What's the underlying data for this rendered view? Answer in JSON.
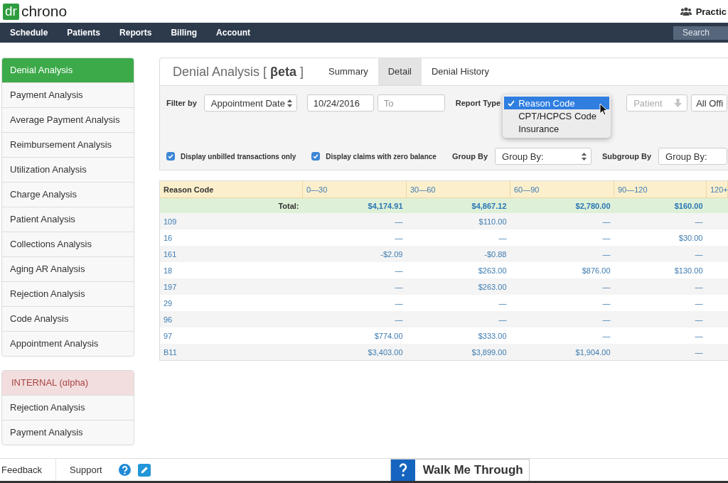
{
  "header": {
    "logo": {
      "mark": "dr",
      "name": "chrono"
    },
    "practice": "Practic"
  },
  "nav": {
    "items": [
      "Schedule",
      "Patients",
      "Reports",
      "Billing",
      "Account"
    ],
    "search": {
      "placeholder": "Search"
    }
  },
  "sidebar": {
    "items": [
      {
        "label": "Denial Analysis",
        "selected": true
      },
      {
        "label": "Payment Analysis",
        "selected": false
      },
      {
        "label": "Average Payment Analysis",
        "selected": false
      },
      {
        "label": "Reimbursement Analysis",
        "selected": false
      },
      {
        "label": "Utilization Analysis",
        "selected": false
      },
      {
        "label": "Charge Analysis",
        "selected": false
      },
      {
        "label": "Patient Analysis",
        "selected": false
      },
      {
        "label": "Collections Analysis",
        "selected": false
      },
      {
        "label": "Aging AR Analysis",
        "selected": false
      },
      {
        "label": "Rejection Analysis",
        "selected": false
      },
      {
        "label": "Code Analysis",
        "selected": false
      },
      {
        "label": "Appointment Analysis",
        "selected": false
      }
    ],
    "internal": {
      "title": "INTERNAL (αlpha)",
      "items": [
        {
          "label": "Rejection Analysis",
          "selected": false
        },
        {
          "label": "Payment Analysis",
          "selected": false
        }
      ]
    }
  },
  "report": {
    "title": "Denial Analysis [ **βeta** ]",
    "tabs": [
      {
        "label": "Summary",
        "selected": false
      },
      {
        "label": "Detail",
        "selected": true
      },
      {
        "label": "Denial History",
        "selected": false
      }
    ]
  },
  "filters": {
    "filter_by": {
      "label": "Filter by",
      "select": "Appointment Date",
      "date_from": "10/24/2016",
      "date_to_placeholder": "To"
    },
    "report_type": {
      "label": "Report Type",
      "options": [
        {
          "label": "Reason Code",
          "selected": true
        },
        {
          "label": "CPT/HCPCS Code",
          "selected": false
        },
        {
          "label": "Insurance",
          "selected": false
        }
      ]
    },
    "patient": {
      "placeholder": "Patient"
    },
    "office": {
      "value": "All Offi"
    },
    "checkboxes": [
      {
        "label": "Display unbilled transactions only",
        "checked": true
      },
      {
        "label": "Display claims with zero balance",
        "checked": true
      }
    ],
    "group_by": {
      "label": "Group By",
      "value": "Group By:"
    },
    "subgroup_by": {
      "label": "Subgroup By",
      "value": "Group By:"
    }
  },
  "table": {
    "columns": [
      "Reason Code",
      "0—30",
      "30—60",
      "60—90",
      "90—120",
      "120+"
    ],
    "total": {
      "label": "Total:",
      "values": [
        "$4,174.91",
        "$4,867.12",
        "$2,780.00",
        "$160.00"
      ]
    },
    "rows": [
      {
        "code": "109",
        "values": [
          "—",
          "$110.00",
          "—",
          "—"
        ]
      },
      {
        "code": "16",
        "values": [
          "—",
          "—",
          "—",
          "$30.00"
        ]
      },
      {
        "code": "161",
        "values": [
          "-$2.09",
          "-$0.88",
          "—",
          "—"
        ]
      },
      {
        "code": "18",
        "values": [
          "—",
          "$263.00",
          "$876.00",
          "$130.00"
        ]
      },
      {
        "code": "197",
        "values": [
          "—",
          "$263.00",
          "—",
          "—"
        ]
      },
      {
        "code": "29",
        "values": [
          "—",
          "—",
          "—",
          "—"
        ]
      },
      {
        "code": "96",
        "values": [
          "—",
          "—",
          "—",
          "—"
        ]
      },
      {
        "code": "97",
        "values": [
          "$774.00",
          "$333.00",
          "—",
          "—"
        ]
      },
      {
        "code": "B11",
        "values": [
          "$3,403.00",
          "$3,899.00",
          "$1,904.00",
          "—"
        ]
      }
    ]
  },
  "footer": {
    "links": [
      "Feedback",
      "Support"
    ],
    "walkme": "Walk Me Through"
  }
}
